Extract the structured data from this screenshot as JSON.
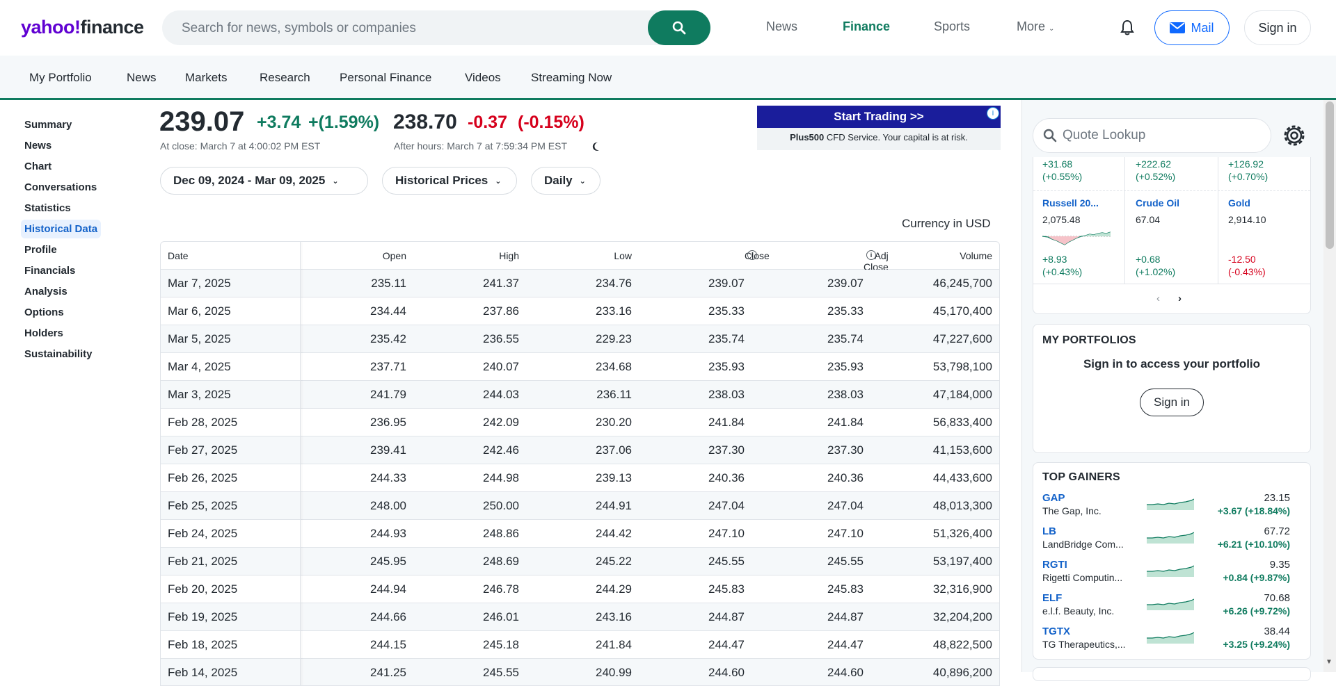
{
  "brand": {
    "logo_yahoo": "yahoo!",
    "logo_finance": "finance"
  },
  "search": {
    "placeholder": "Search for news, symbols or companies"
  },
  "topnav": {
    "news": "News",
    "finance": "Finance",
    "sports": "Sports",
    "more": "More"
  },
  "header_buttons": {
    "mail": "Mail",
    "signin": "Sign in"
  },
  "subnav": [
    "My Portfolio",
    "News",
    "Markets",
    "Research",
    "Personal Finance",
    "Videos",
    "Streaming Now"
  ],
  "leftnav": [
    "Summary",
    "News",
    "Chart",
    "Conversations",
    "Statistics",
    "Historical Data",
    "Profile",
    "Financials",
    "Analysis",
    "Options",
    "Holders",
    "Sustainability"
  ],
  "quote": {
    "price": "239.07",
    "change": "+3.74",
    "change_pct": "+(1.59%)",
    "after_price": "238.70",
    "after_change": "-0.37",
    "after_change_pct": "(-0.15%)",
    "close_note": "At close: March 7 at 4:00:02 PM EST",
    "after_note": "After hours: March 7 at 7:59:34 PM EST"
  },
  "controls": {
    "date_range": "Dec 09, 2024 - Mar 09, 2025",
    "type": "Historical Prices",
    "frequency": "Daily"
  },
  "ad": {
    "cta": "Start Trading >>",
    "brand": "Plus500",
    "text": " CFD Service. Your capital is at risk."
  },
  "currency_note": "Currency in USD",
  "table": {
    "headers": [
      "Date",
      "Open",
      "High",
      "Low",
      "Close",
      "Adj Close",
      "Volume"
    ],
    "rows": [
      [
        "Mar 7, 2025",
        "235.11",
        "241.37",
        "234.76",
        "239.07",
        "239.07",
        "46,245,700"
      ],
      [
        "Mar 6, 2025",
        "234.44",
        "237.86",
        "233.16",
        "235.33",
        "235.33",
        "45,170,400"
      ],
      [
        "Mar 5, 2025",
        "235.42",
        "236.55",
        "229.23",
        "235.74",
        "235.74",
        "47,227,600"
      ],
      [
        "Mar 4, 2025",
        "237.71",
        "240.07",
        "234.68",
        "235.93",
        "235.93",
        "53,798,100"
      ],
      [
        "Mar 3, 2025",
        "241.79",
        "244.03",
        "236.11",
        "238.03",
        "238.03",
        "47,184,000"
      ],
      [
        "Feb 28, 2025",
        "236.95",
        "242.09",
        "230.20",
        "241.84",
        "241.84",
        "56,833,400"
      ],
      [
        "Feb 27, 2025",
        "239.41",
        "242.46",
        "237.06",
        "237.30",
        "237.30",
        "41,153,600"
      ],
      [
        "Feb 26, 2025",
        "244.33",
        "244.98",
        "239.13",
        "240.36",
        "240.36",
        "44,433,600"
      ],
      [
        "Feb 25, 2025",
        "248.00",
        "250.00",
        "244.91",
        "247.04",
        "247.04",
        "48,013,300"
      ],
      [
        "Feb 24, 2025",
        "244.93",
        "248.86",
        "244.42",
        "247.10",
        "247.10",
        "51,326,400"
      ],
      [
        "Feb 21, 2025",
        "245.95",
        "248.69",
        "245.22",
        "245.55",
        "245.55",
        "53,197,400"
      ],
      [
        "Feb 20, 2025",
        "244.94",
        "246.78",
        "244.29",
        "245.83",
        "245.83",
        "32,316,900"
      ],
      [
        "Feb 19, 2025",
        "244.66",
        "246.01",
        "243.16",
        "244.87",
        "244.87",
        "32,204,200"
      ],
      [
        "Feb 18, 2025",
        "244.15",
        "245.18",
        "241.84",
        "244.47",
        "244.47",
        "48,822,500"
      ],
      [
        "Feb 14, 2025",
        "241.25",
        "245.55",
        "240.99",
        "244.60",
        "244.60",
        "40,896,200"
      ]
    ]
  },
  "sidebar": {
    "quote_lookup": "Quote Lookup",
    "markets_top_row": [
      {
        "change": "+31.68",
        "pct": "(+0.55%)"
      },
      {
        "change": "+222.62",
        "pct": "(+0.52%)"
      },
      {
        "change": "+126.92",
        "pct": "(+0.70%)"
      }
    ],
    "markets": [
      {
        "name": "Russell 20...",
        "value": "2,075.48",
        "change": "+8.93",
        "pct": "(+0.43%)",
        "color": "#0f7b5f"
      },
      {
        "name": "Crude Oil",
        "value": "67.04",
        "change": "+0.68",
        "pct": "(+1.02%)",
        "color": "#0f7b5f"
      },
      {
        "name": "Gold",
        "value": "2,914.10",
        "change": "-12.50",
        "pct": "(-0.43%)",
        "color": "#d6001c"
      }
    ],
    "portfolio_title": "MY PORTFOLIOS",
    "portfolio_prompt": "Sign in to access your portfolio",
    "portfolio_signin": "Sign in",
    "gainers_title": "TOP GAINERS",
    "gainers": [
      {
        "sym": "GAP",
        "name": "The Gap, Inc.",
        "price": "23.15",
        "change": "+3.67 (+18.84%)"
      },
      {
        "sym": "LB",
        "name": "LandBridge Com...",
        "price": "67.72",
        "change": "+6.21 (+10.10%)"
      },
      {
        "sym": "RGTI",
        "name": "Rigetti Computin...",
        "price": "9.35",
        "change": "+0.84 (+9.87%)"
      },
      {
        "sym": "ELF",
        "name": "e.l.f. Beauty, Inc.",
        "price": "70.68",
        "change": "+6.26 (+9.72%)"
      },
      {
        "sym": "TGTX",
        "name": "TG Therapeutics,...",
        "price": "38.44",
        "change": "+3.25 (+9.24%)"
      }
    ]
  }
}
